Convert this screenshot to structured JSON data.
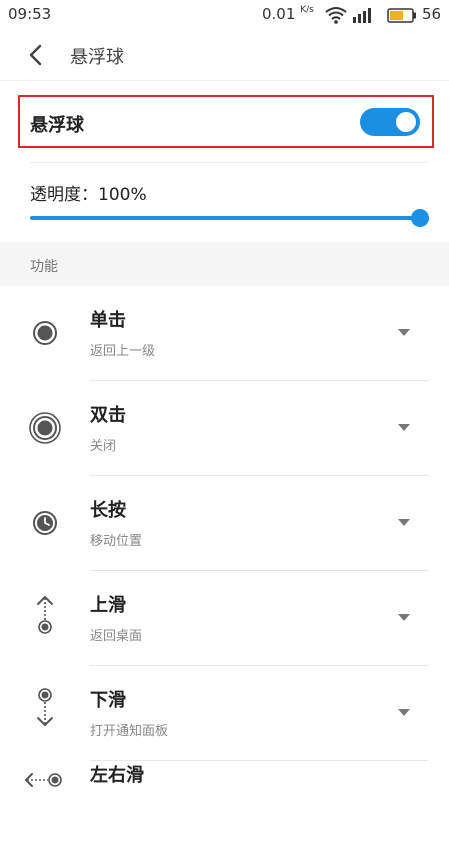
{
  "status_bar": {
    "time": "09:53",
    "speed_value": "0.01",
    "speed_unit": "K/s",
    "battery": "56"
  },
  "header": {
    "title": "悬浮球"
  },
  "floating_ball": {
    "label": "悬浮球",
    "enabled": true
  },
  "opacity": {
    "label": "透明度：100%",
    "value_percent": 100
  },
  "section": {
    "label": "功能"
  },
  "functions": [
    {
      "title": "单击",
      "value": "返回上一级",
      "icon": "dot-icon"
    },
    {
      "title": "双击",
      "value": "关闭",
      "icon": "double-ring-icon"
    },
    {
      "title": "长按",
      "value": "移动位置",
      "icon": "clock-icon"
    },
    {
      "title": "上滑",
      "value": "返回桌面",
      "icon": "swipe-up-icon"
    },
    {
      "title": "下滑",
      "value": "打开通知面板",
      "icon": "swipe-down-icon"
    },
    {
      "title": "左右滑",
      "value": "",
      "icon": "swipe-horizontal-icon"
    }
  ],
  "colors": {
    "accent": "#1a8fe3",
    "highlight_border": "#d62a2a"
  }
}
